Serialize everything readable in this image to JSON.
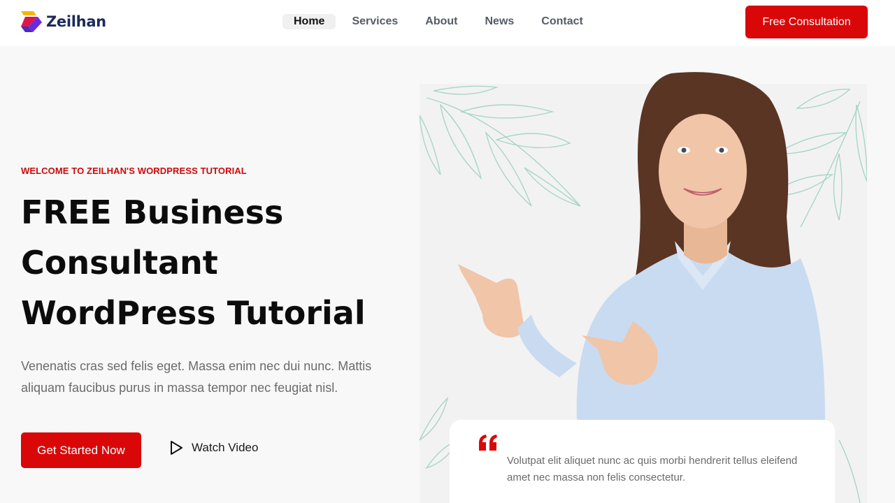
{
  "header": {
    "brand": "Zeilhan",
    "nav": [
      {
        "label": "Home",
        "active": true
      },
      {
        "label": "Services",
        "active": false
      },
      {
        "label": "About",
        "active": false
      },
      {
        "label": "News",
        "active": false
      },
      {
        "label": "Contact",
        "active": false
      }
    ],
    "cta_label": "Free Consultation"
  },
  "hero": {
    "eyebrow": "WELCOME TO ZEILHAN'S WORDPRESS TUTORIAL",
    "headline_lines": [
      "FREE Business",
      "Consultant",
      "WordPress Tutorial"
    ],
    "lead_lines": [
      "Venenatis cras sed felis eget. Massa enim nec dui nunc. Mattis",
      "aliquam faucibus purus in massa tempor nec feugiat nisl."
    ],
    "primary_button": "Get Started Now",
    "video_button": "Watch Video",
    "icons": {
      "play": "play-icon",
      "quote": "quote-icon"
    }
  },
  "testimonial": {
    "lines": [
      "Volutpat elit aliquet nunc ac quis morbi hendrerit tellus eleifend",
      "amet nec massa non felis consectetur."
    ]
  },
  "colors": {
    "accent": "#d90708",
    "brand_navy": "#1e2a5a",
    "leaf": "#a9d6c4",
    "shirt": "#c9dbf0",
    "hair": "#5a3523",
    "skin": "#f0c5a8"
  }
}
